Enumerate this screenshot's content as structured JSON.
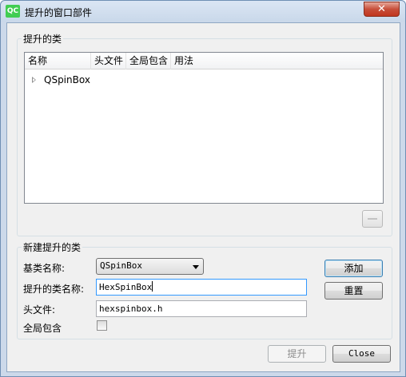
{
  "window": {
    "title": "提升的窗口部件",
    "icon_text": "QC",
    "close_glyph": "✕"
  },
  "promoted_classes": {
    "group_title": "提升的类",
    "columns": [
      "名称",
      "头文件",
      "全局包含",
      "用法"
    ],
    "rows": [
      {
        "name": "QSpinBox"
      }
    ]
  },
  "new_promoted": {
    "group_title": "新建提升的类",
    "base_class_label": "基类名称:",
    "base_class_value": "QSpinBox",
    "class_name_label": "提升的类名称:",
    "class_name_value": "HexSpinBox",
    "header_label": "头文件:",
    "header_value": "hexspinbox.h",
    "global_include_label": "全局包含",
    "global_include_checked": false,
    "add_button": "添加",
    "reset_button": "重置"
  },
  "footer": {
    "promote_button": "提升",
    "close_button": "Close"
  }
}
